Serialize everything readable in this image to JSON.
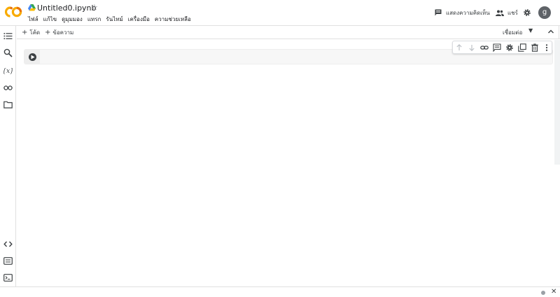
{
  "header": {
    "filename": "Untitled0.ipynb",
    "menu": [
      "ไฟล์",
      "แก้ไข",
      "ดูมุมมอง",
      "แทรก",
      "รันไทม์",
      "เครื่องมือ",
      "ความช่วยเหลือ"
    ],
    "comment_label": "แสดงความคิดเห็น",
    "share_label": "แชร์",
    "avatar_letter": "g"
  },
  "toolbar": {
    "add_code_label": "โค้ด",
    "add_text_label": "ข้อความ",
    "connect_label": "เชื่อมต่อ"
  },
  "cell_toolbar": {
    "icons": [
      "move-up-icon",
      "move-down-icon",
      "link-icon",
      "comment-icon",
      "settings-icon",
      "mirror-cell-icon",
      "delete-icon",
      "more-icon"
    ]
  },
  "sidebar": {
    "icons": [
      "table-of-contents-icon",
      "search-icon",
      "variables-icon",
      "secrets-key-icon",
      "files-folder-icon",
      "code-snippets-icon",
      "command-palette-icon",
      "terminal-icon"
    ]
  },
  "colors": {
    "logo_orange": "#F9AB00",
    "logo_dark_orange": "#E8710A",
    "avatar_bg": "#5f6368",
    "border": "#e0e0e0",
    "cell_bg": "#f7f7f7"
  }
}
